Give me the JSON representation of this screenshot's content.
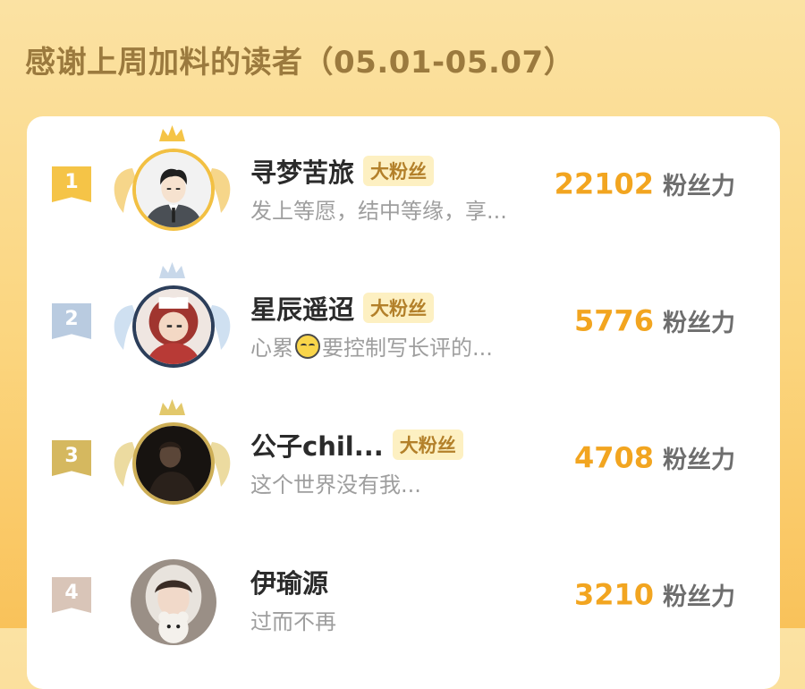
{
  "title": "感谢上周加料的读者（05.01-05.07）",
  "colors": {
    "accent": "#f2a520",
    "title": "#9b7a3e",
    "tag_bg": "#fdf0c2"
  },
  "readers": [
    {
      "rank": "1",
      "name": "寻梦苦旅",
      "tag": "大粉丝",
      "message": "发上等愿，结中等缘，享...",
      "score": "22102",
      "unit": "粉丝力"
    },
    {
      "rank": "2",
      "name": "星辰遥迢",
      "tag": "大粉丝",
      "message_before": "心累",
      "message_emoji": "sweat-emoji",
      "message_after": "要控制写长评的...",
      "score": "5776",
      "unit": "粉丝力"
    },
    {
      "rank": "3",
      "name": "公子chil...",
      "tag": "大粉丝",
      "message": "这个世界没有我...",
      "score": "4708",
      "unit": "粉丝力"
    },
    {
      "rank": "4",
      "name": "伊瑜源",
      "message": "过而不再",
      "score": "3210",
      "unit": "粉丝力"
    }
  ]
}
